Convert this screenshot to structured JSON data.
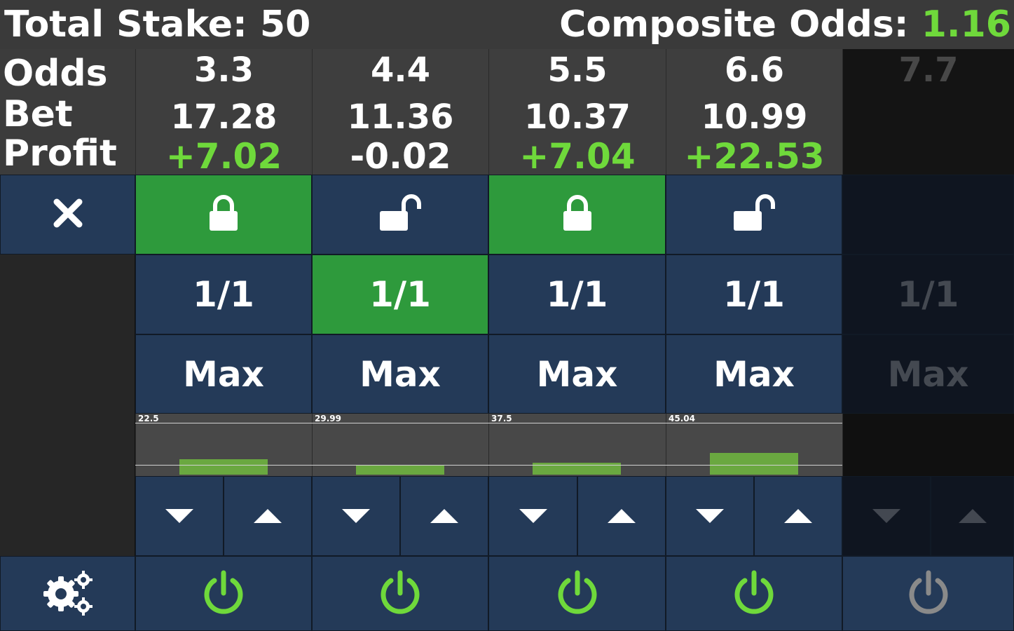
{
  "header": {
    "total_stake_label": "Total Stake:",
    "total_stake_value": "50",
    "composite_odds_label": "Composite Odds:",
    "composite_odds_value": "1.16"
  },
  "row_labels": {
    "odds": "Odds",
    "bet": "Bet",
    "profit": "Profit"
  },
  "columns": [
    {
      "odds": "3.3",
      "bet": "17.28",
      "profit": "+7.02",
      "profit_color": "#6fd93b",
      "locked": true,
      "ratio": "1/1",
      "ratio_active": false,
      "max_label": "Max",
      "bar_label": "22.5",
      "bar_fraction": 0.36
    },
    {
      "odds": "4.4",
      "bet": "11.36",
      "profit": "-0.02",
      "profit_color": "#ffffff",
      "locked": false,
      "ratio": "1/1",
      "ratio_active": true,
      "max_label": "Max",
      "bar_label": "29.99",
      "bar_fraction": 0.22
    },
    {
      "odds": "5.5",
      "bet": "10.37",
      "profit": "+7.04",
      "profit_color": "#6fd93b",
      "locked": true,
      "ratio": "1/1",
      "ratio_active": false,
      "max_label": "Max",
      "bar_label": "37.5",
      "bar_fraction": 0.28
    },
    {
      "odds": "6.6",
      "bet": "10.99",
      "profit": "+22.53",
      "profit_color": "#6fd93b",
      "locked": false,
      "ratio": "1/1",
      "ratio_active": false,
      "max_label": "Max",
      "bar_label": "45.04",
      "bar_fraction": 0.51
    },
    {
      "odds": "7.7",
      "bet": "",
      "profit": "",
      "disabled": true,
      "ratio": "1/1",
      "max_label": "Max"
    }
  ],
  "icons": {
    "remove": "close-icon",
    "locked": "lock-closed-icon",
    "unlocked": "lock-open-icon",
    "decrease": "triangle-down-icon",
    "increase": "triangle-up-icon",
    "power": "power-icon",
    "settings": "gears-icon"
  },
  "colors": {
    "accent_green": "#6fd93b",
    "active_cell": "#2e9a3c",
    "cell_blue": "#243a58",
    "header_bg": "#3a3a3a",
    "power_disabled": "#8a8a8a"
  }
}
